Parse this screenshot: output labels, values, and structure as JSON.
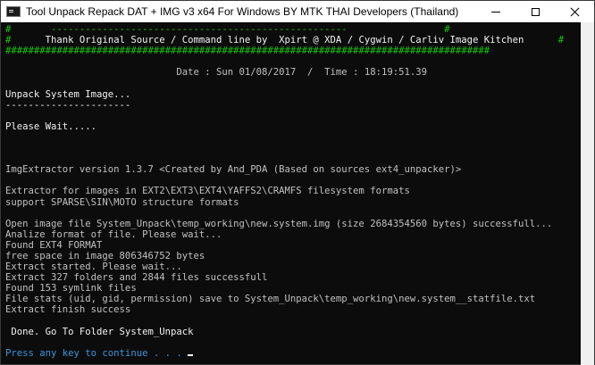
{
  "window": {
    "title": "Tool Unpack Repack DAT + IMG v3 x64 For Windows BY MTK THAI Developers (Thailand)"
  },
  "console": {
    "header_border": "#       ----------------------------------------------------                 #",
    "header_credit": "#      Thank Original Source / Command line by  Xpirt @ XDA / Cygwin / Carliv Image Kitchen      #",
    "header_hashes": "#####################################################################################",
    "date_line": "Date : Sun 01/08/2017  /  Time : 18:19:51.39",
    "section_title": "Unpack System Image...",
    "section_underline": "----------------------",
    "please_wait": "Please Wait.....",
    "img_version": "ImgExtractor version 1.3.7 <Created by And_PDA (Based on sources ext4_unpacker)>",
    "extractor_desc": "Extractor for images in EXT2\\EXT3\\EXT4\\YAFFS2\\CRAMFS filesystem formats",
    "support_desc": "support SPARSE\\SIN\\MOTO structure formats",
    "log": [
      "Open image file System_Unpack\\temp_working\\new.system.img (size 2684354560 bytes) successfull...",
      "Analize format of file. Please wait...",
      "Found EXT4 FORMAT",
      "free space in image 806346752 bytes",
      "Extract started. Please wait...",
      "Extract 327 folders and 2844 files successfull",
      "Found 153 symlink files",
      "File stats (uid, gid, permission) save to System_Unpack\\temp_working\\new.system__statfile.txt",
      "Extract finish success"
    ],
    "done_line": " Done. Go To Folder System_Unpack",
    "prompt": "Press any key to continue . . . "
  }
}
